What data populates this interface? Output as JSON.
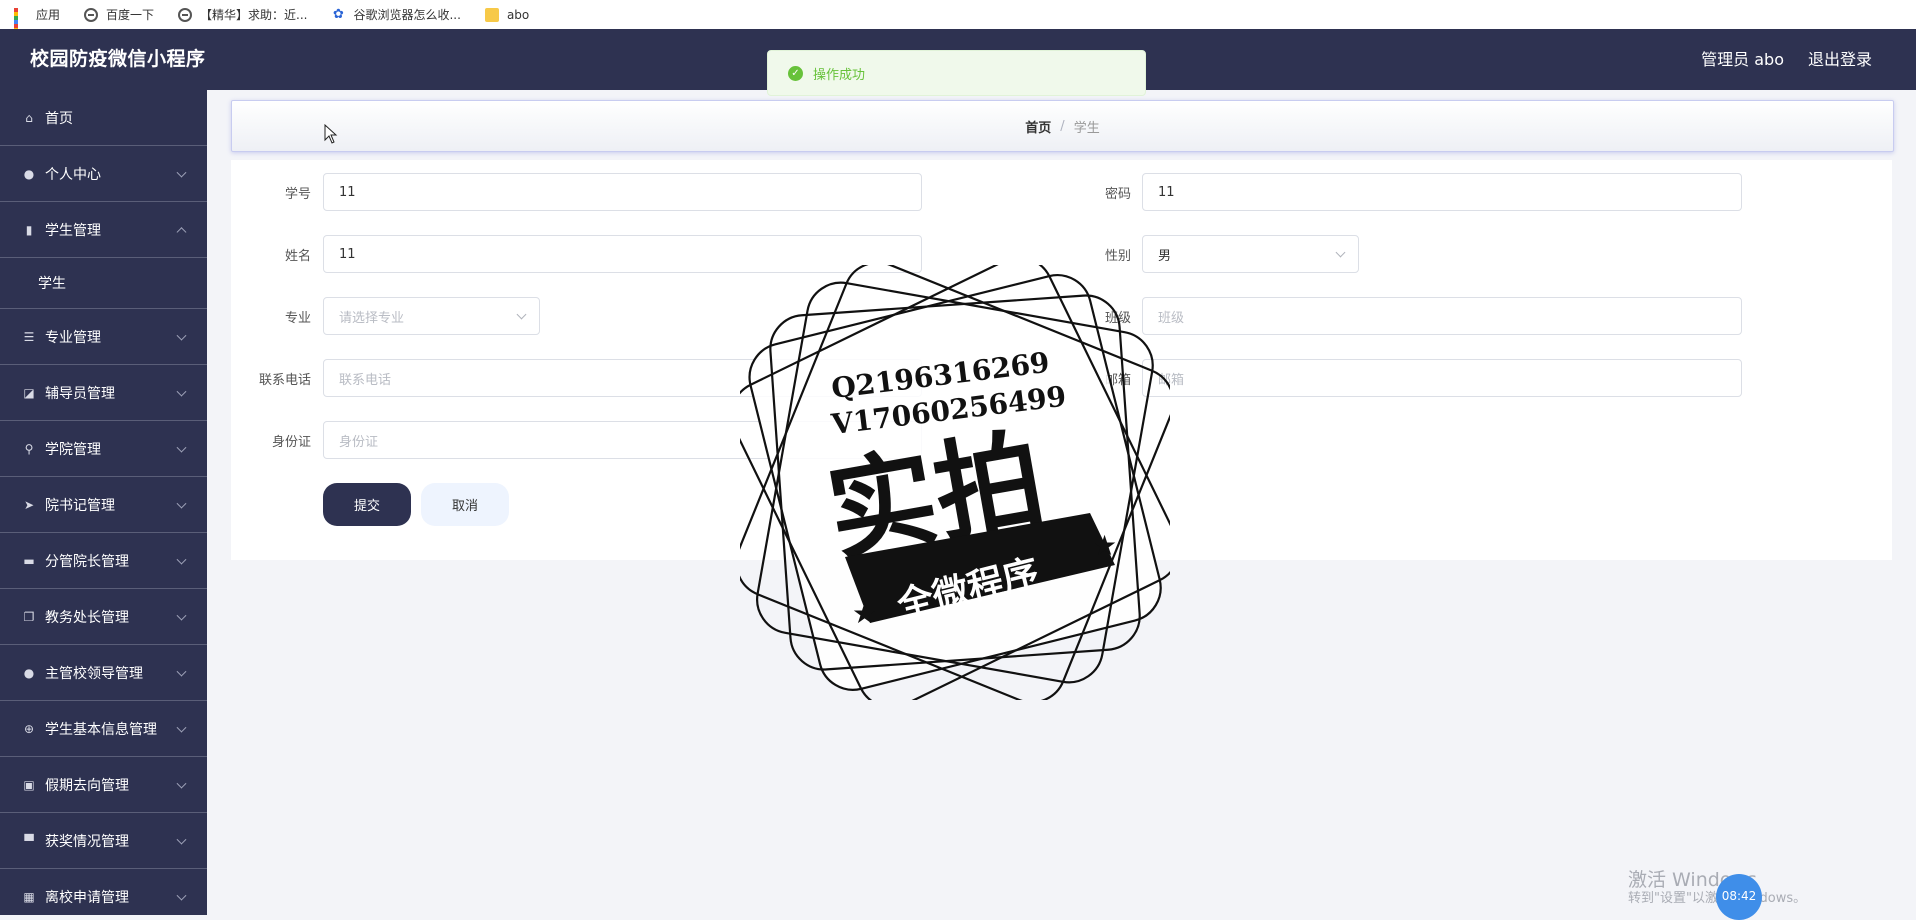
{
  "bookmarks": [
    {
      "label": "应用",
      "icon": "apps-grid-icon"
    },
    {
      "label": "百度一下",
      "icon": "globe-icon"
    },
    {
      "label": "【精华】求助：近...",
      "icon": "globe-icon"
    },
    {
      "label": "谷歌浏览器怎么收...",
      "icon": "baidu-paw-icon"
    },
    {
      "label": "abo",
      "icon": "folder-icon"
    }
  ],
  "header": {
    "title": "校园防疫微信小程序",
    "user": "管理员 abo",
    "logout": "退出登录"
  },
  "toast": {
    "message": "操作成功",
    "type": "success",
    "color": "#67c23a"
  },
  "sidebar": {
    "items": [
      {
        "label": "首页",
        "icon": "home-icon",
        "expandable": false
      },
      {
        "label": "个人中心",
        "icon": "user-icon",
        "expandable": true
      },
      {
        "label": "学生管理",
        "icon": "books-icon",
        "expandable": true,
        "expanded": true,
        "children": [
          {
            "label": "学生"
          }
        ]
      },
      {
        "label": "专业管理",
        "icon": "list-icon",
        "expandable": true
      },
      {
        "label": "辅导员管理",
        "icon": "chart-icon",
        "expandable": true
      },
      {
        "label": "学院管理",
        "icon": "microphone-icon",
        "expandable": true
      },
      {
        "label": "院书记管理",
        "icon": "send-icon",
        "expandable": true
      },
      {
        "label": "分管院长管理",
        "icon": "monitor-icon",
        "expandable": true
      },
      {
        "label": "教务处长管理",
        "icon": "copy-icon",
        "expandable": true
      },
      {
        "label": "主管校领导管理",
        "icon": "person-icon",
        "expandable": true
      },
      {
        "label": "学生基本信息管理",
        "icon": "compass-icon",
        "expandable": true
      },
      {
        "label": "假期去向管理",
        "icon": "clipboard-icon",
        "expandable": true
      },
      {
        "label": "获奖情况管理",
        "icon": "trophy-icon",
        "expandable": true
      },
      {
        "label": "离校申请管理",
        "icon": "calendar-icon",
        "expandable": true
      }
    ]
  },
  "breadcrumb": {
    "home": "首页",
    "separator": "/",
    "current": "学生"
  },
  "form": {
    "student_id": {
      "label": "学号",
      "value": "11"
    },
    "password": {
      "label": "密码",
      "value": "11"
    },
    "name": {
      "label": "姓名",
      "value": "11"
    },
    "gender": {
      "label": "性别",
      "value": "男"
    },
    "major": {
      "label": "专业",
      "placeholder": "请选择专业"
    },
    "class": {
      "label": "班级",
      "placeholder": "班级"
    },
    "phone": {
      "label": "联系电话",
      "placeholder": "联系电话"
    },
    "email": {
      "label": "邮箱",
      "placeholder": "邮箱"
    },
    "id_card": {
      "label": "身份证",
      "placeholder": "身份证"
    },
    "submit": "提交",
    "cancel": "取消"
  },
  "watermark": {
    "line1": "Q2196316269",
    "line2": "V17060256499",
    "main": "实拍",
    "ribbon": "全微程序"
  },
  "windows": {
    "activate": "激活 Windows",
    "hint": "转到\"设置\"以激活 Windows。",
    "time": "08:42"
  },
  "colors": {
    "sidebar_bg": "#2e3251",
    "primary_button": "#2e3251",
    "success": "#67c23a"
  }
}
